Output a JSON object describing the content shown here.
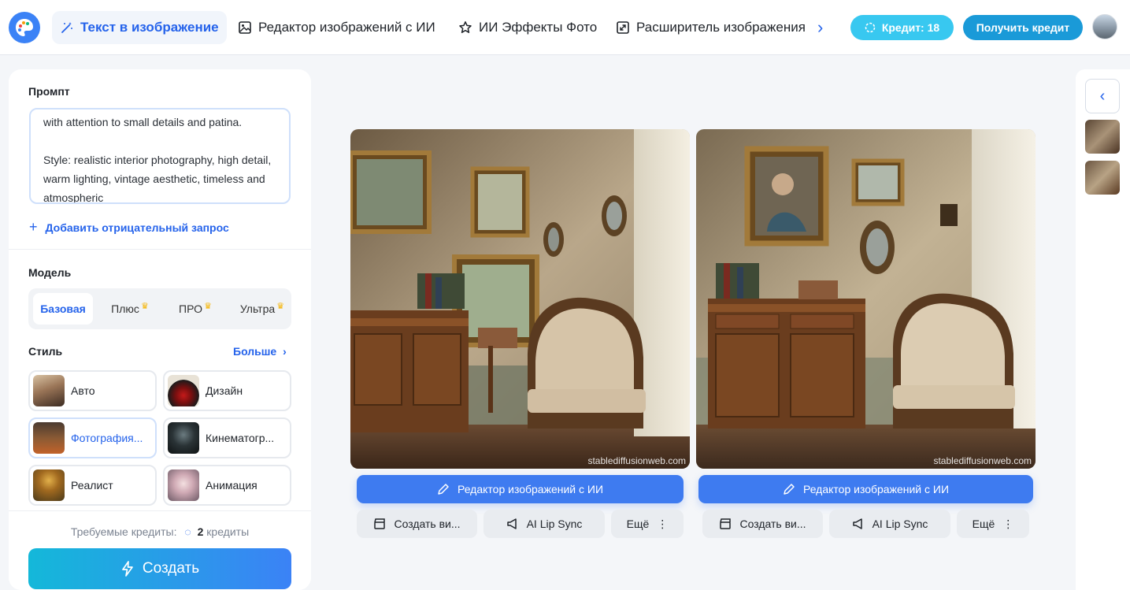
{
  "nav": {
    "items": [
      {
        "label": "Текст в изображение",
        "icon": "magic-wand-icon"
      },
      {
        "label": "Редактор изображений с ИИ",
        "icon": "image-icon"
      },
      {
        "label": "ИИ Эффекты Фото",
        "icon": "star-icon"
      },
      {
        "label": "Расширитель изображения",
        "icon": "expand-icon"
      }
    ],
    "credit_label": "Кредит: 18",
    "get_credit_label": "Получить кредит"
  },
  "prompt": {
    "title": "Промпт",
    "text": "with attention to small details and patina.\n\nStyle: realistic interior photography, high detail, warm lighting, vintage aesthetic, timeless and atmospheric",
    "negative_link": "Добавить отрицательный запрос"
  },
  "model": {
    "title": "Модель",
    "tabs": [
      "Базовая",
      "Плюс",
      "ПРО",
      "Ультра"
    ]
  },
  "style": {
    "title": "Стиль",
    "more": "Больше",
    "items": [
      "Авто",
      "Дизайн",
      "Фотография...",
      "Кинематогр...",
      "Реалист",
      "Анимация"
    ]
  },
  "footer": {
    "required_label": "Требуемые кредиты:",
    "required_value": "2",
    "required_unit": "кредиты",
    "create_label": "Создать"
  },
  "results": {
    "watermark": "stablediffusionweb.com",
    "edit_label": "Редактор изображений с ИИ",
    "video_label": "Создать ви...",
    "lipsync_label": "AI Lip Sync",
    "more_label": "Ещё"
  },
  "colors": {
    "accent": "#2563eb",
    "credit_pill": "#38c8f0",
    "get_credit": "#1a9ad8"
  }
}
